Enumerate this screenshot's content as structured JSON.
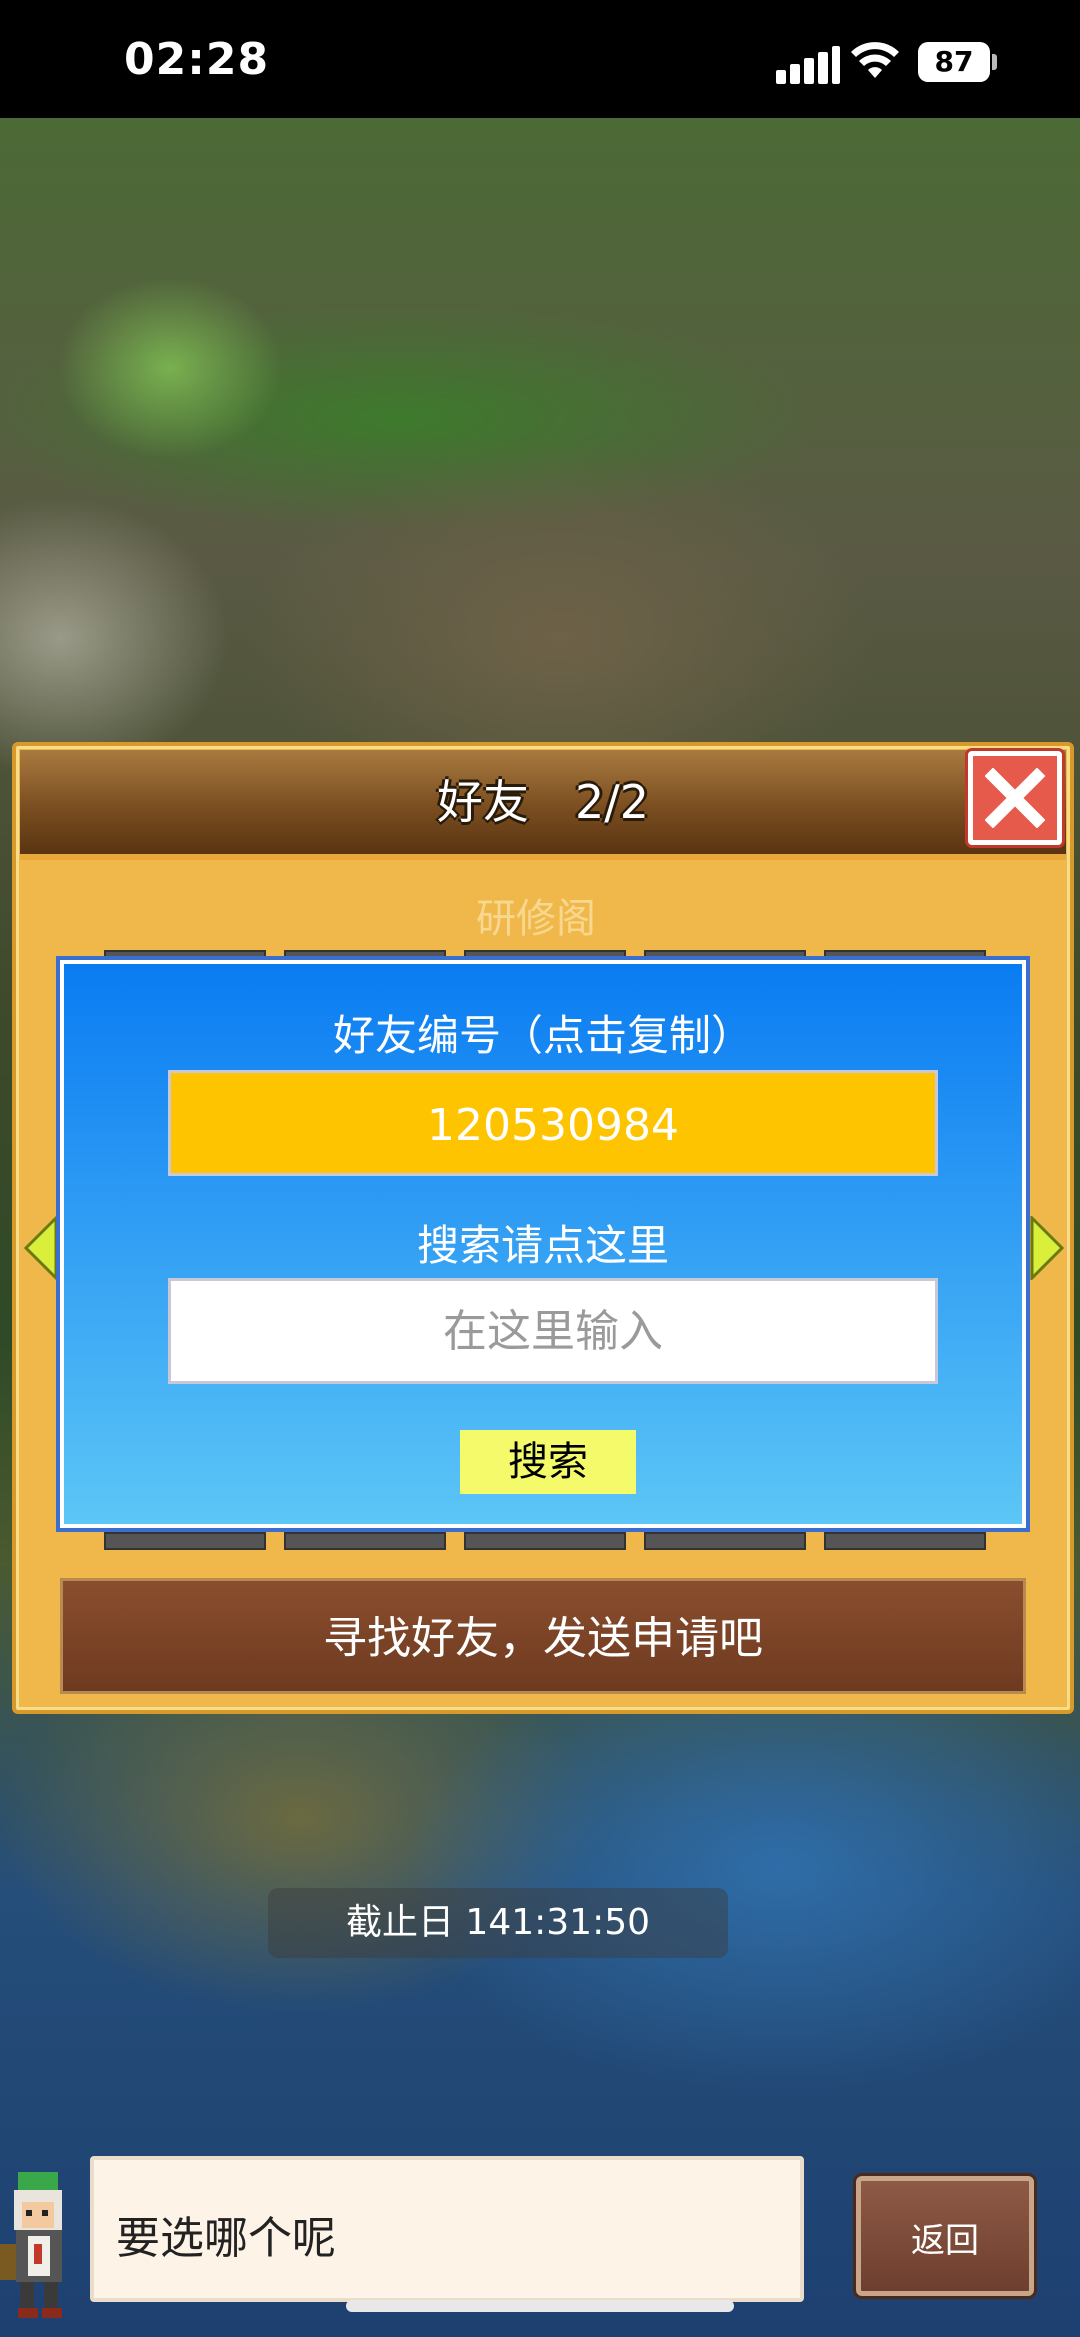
{
  "status_bar": {
    "time": "02:28",
    "battery": "87"
  },
  "dialog": {
    "title": "好友　2/2",
    "ghost_tab_label": "研修阁",
    "panel": {
      "friend_id_label": "好友编号（点击复制）",
      "friend_id": "120530984",
      "search_label": "搜索请点这里",
      "search_placeholder": "在这里输入",
      "search_button": "搜索"
    },
    "action_text": "寻找好友，发送申请吧"
  },
  "deadline": "截止日 141:31:50",
  "speech": "要选哪个呢",
  "back_button": "返回",
  "colors": {
    "dialog_frame": "#f0b84a",
    "panel_blue": "#0a7cf2",
    "friend_id_bg": "#ffc400",
    "search_button_bg": "#f4fa6a",
    "close_red": "#e55a4a",
    "action_brown": "#7a4128"
  },
  "icons": [
    "close-icon",
    "arrow-left-icon",
    "arrow-right-icon",
    "signal-icon",
    "wifi-icon",
    "battery-icon"
  ]
}
